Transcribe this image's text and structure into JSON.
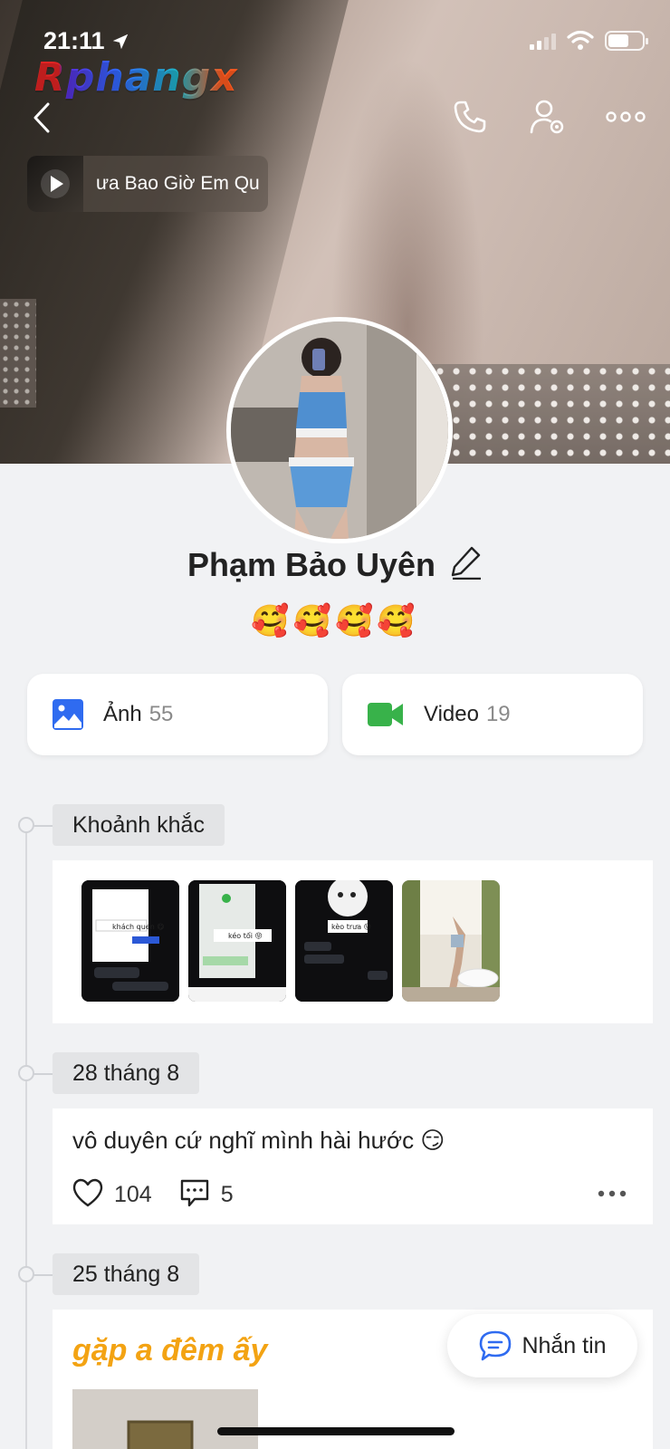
{
  "status_bar": {
    "time": "21:11",
    "battery_level": 0.62
  },
  "overlay_logo": "Rphangx",
  "music": {
    "title": "ưa Bao Giờ Em Qu"
  },
  "profile": {
    "name": "Phạm Bảo Uyên",
    "bio": "🥰🥰🥰🥰"
  },
  "media": {
    "photos": {
      "label": "Ảnh",
      "count": "55"
    },
    "videos": {
      "label": "Video",
      "count": "19"
    }
  },
  "moments": {
    "label": "Khoảnh khắc",
    "thumbs": [
      {
        "caption": "khách quen 😋"
      },
      {
        "caption": "kéo tối 😝"
      },
      {
        "caption": "kèo trưa 😝"
      },
      {
        "caption": ""
      }
    ]
  },
  "posts": [
    {
      "date": "28 tháng 8",
      "text": "vô duyên cứ nghĩ mình hài hước 😏",
      "likes": "104",
      "comments": "5"
    },
    {
      "date": "25 tháng 8",
      "text": "gặp a đêm ấy"
    }
  ],
  "message_button": {
    "label": "Nhắn tin"
  },
  "colors": {
    "accent_blue": "#2f6bf0",
    "video_green": "#38b24a",
    "highlight_orange": "#f3a313"
  }
}
